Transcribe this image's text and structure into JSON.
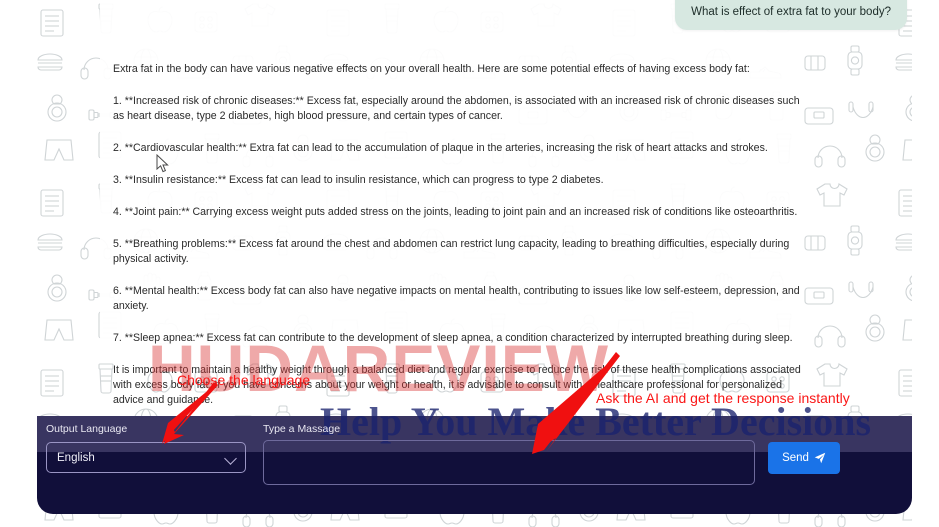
{
  "app": {
    "watermark_primary": "HUDAREVIEW",
    "watermark_secondary": "Help You Make Better Decisions"
  },
  "chat": {
    "user_message": "What is effect of extra fat to your body?",
    "assistant_paragraphs": [
      "Extra fat in the body can have various negative effects on your overall health. Here are some potential effects of having excess body fat:",
      "1. **Increased risk of chronic diseases:** Excess fat, especially around the abdomen, is associated with an increased risk of chronic diseases such as heart disease, type 2 diabetes, high blood pressure, and certain types of cancer.",
      "2. **Cardiovascular health:** Extra fat can lead to the accumulation of plaque in the arteries, increasing the risk of heart attacks and strokes.",
      "3. **Insulin resistance:** Excess fat can lead to insulin resistance, which can progress to type 2 diabetes.",
      "4. **Joint pain:** Carrying excess weight puts added stress on the joints, leading to joint pain and an increased risk of conditions like osteoarthritis.",
      "5. **Breathing problems:** Excess fat around the chest and abdomen can restrict lung capacity, leading to breathing difficulties, especially during physical activity.",
      "6. **Mental health:** Excess body fat can also have negative impacts on mental health, contributing to issues like low self-esteem, depression, and anxiety.",
      "7. **Sleep apnea:** Excess fat can contribute to the development of sleep apnea, a condition characterized by interrupted breathing during sleep.",
      "It is important to maintain a healthy weight through a balanced diet and regular exercise to reduce the risk of these health complications associated with excess body fat. If you have concerns about your weight or health, it is advisable to consult with a healthcare professional for personalized advice and guidance."
    ]
  },
  "composer": {
    "output_language_label": "Output Language",
    "output_language_value": "English",
    "message_label": "Type a Massage",
    "message_value": "",
    "message_placeholder": "",
    "send_label": "Send"
  },
  "annotations": {
    "choose_language": "Choose the language",
    "ask_ai": "Ask the AI and get the response instantly",
    "color": "#fa1616"
  },
  "colors": {
    "panel_dark": "#110f3a",
    "panel_dark_top": "#3b3763",
    "send_blue": "#1a73e8",
    "user_bubble": "#d7e8e1",
    "watermark_red": "#d83232",
    "watermark_navy": "#1a236e"
  }
}
